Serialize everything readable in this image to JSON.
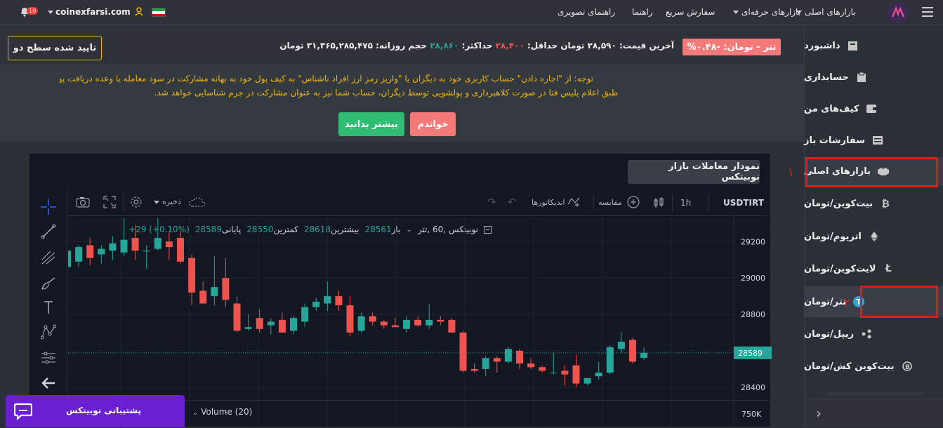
{
  "topbar": {
    "notification_count": "10",
    "domain": "coinexfarsi.com",
    "nav_main_markets": "بازارهای اصلی",
    "nav_pro_markets": "بازارهای حرفه‌ای",
    "nav_quick_order": "سفارش سریع",
    "nav_guide": "راهنما",
    "nav_video_guide": "راهنمای تصویری"
  },
  "sidebar": {
    "dashboard": "داشبورد",
    "accounting": "حسابداری",
    "wallets": "کیف‌های من",
    "open_orders": "سفارشات باز",
    "main_markets": "بازارهای اصلی",
    "btc": "بیت‌کوین/تومان",
    "eth": "اتریوم/تومان",
    "ltc": "لایت‌کوین/تومان",
    "usdt": "تتر/تومان",
    "xrp": "ریپل/تومان",
    "bch": "بیت‌کوین کش/تومان",
    "annot1": "۱",
    "annot2": "۲"
  },
  "infobar": {
    "verify_button": "تایید شده سطح دو",
    "pair_badge": "تتر - تومان: -۰.۴۸%",
    "last_price_label": "آخرین قیمت:",
    "last_price": "۲۸,۵۹۰ تومان",
    "min_label": "حداقل:",
    "min_value": "۲۸,۴۰۰",
    "max_label": "حداکثر:",
    "max_value": "۲۸,۸۶۰",
    "volume_label": "حجم روزانه:",
    "volume_value": "۳۱,۳۶۵,۲۸۵,۴۷۵ تومان"
  },
  "notice": {
    "line1": "توجه: از \"اجاره دادن\" حساب کاربری خود به دیگران یا \"واریز رمز ارز افراد ناشناس\" به کیف پول خود به بهانه مشارکت در سود معامله یا وعده دریافت پول جدا خودداری کنید.",
    "line2": "طبق اعلام پلیس فتا در صورت کلاهبرداری و پولشویی توسط دیگران، حساب شما نیز به عنوان مشارکت در جرم شناسایی خواهد شد.",
    "read_button": "خواندم",
    "learn_more_button": "بیشتر بدانید"
  },
  "chart_panel": {
    "title": "نمودار معاملات بازار نوبیتکس",
    "symbol": "USDTIRT",
    "interval": "1h",
    "compare": "مقایسه",
    "indicators": "اندیکاتورها",
    "save": "ذخیره",
    "legend_name": "نوبیتکس ,60 ,تتر",
    "open_label": "باز",
    "open_value": "28561",
    "high_label": "بیشترین",
    "high_value": "28618",
    "low_label": "کمترین",
    "low_value": "28550",
    "close_label": "پایانی",
    "close_value": "28589",
    "change": "+29 (+0.10%)",
    "volume_label": "Volume (20)",
    "volume_axis": "750K",
    "price_tag": "28589"
  },
  "support": {
    "label": "پشتیبانی نوبیتکس"
  },
  "colors": {
    "up": "#26a69a",
    "down": "#ef5350",
    "annotation": "#e21b1b",
    "accent_yellow": "#f0b90b"
  },
  "chart_data": {
    "type": "candlestick",
    "y_ticks": [
      29200,
      29000,
      28800,
      28600,
      28400
    ],
    "ylim": [
      28330,
      29340
    ],
    "last_price": 28589,
    "candles": [
      {
        "o": 29060,
        "h": 29120,
        "l": 28990,
        "c": 29150
      },
      {
        "o": 29090,
        "h": 29180,
        "l": 29060,
        "c": 29170
      },
      {
        "o": 29180,
        "h": 29220,
        "l": 29070,
        "c": 29110
      },
      {
        "o": 29130,
        "h": 29180,
        "l": 29080,
        "c": 29160
      },
      {
        "o": 29150,
        "h": 29230,
        "l": 29100,
        "c": 29190
      },
      {
        "o": 29140,
        "h": 29330,
        "l": 29120,
        "c": 29210
      },
      {
        "o": 29220,
        "h": 29290,
        "l": 29100,
        "c": 29150
      },
      {
        "o": 29150,
        "h": 29180,
        "l": 29050,
        "c": 29150
      },
      {
        "o": 29160,
        "h": 29330,
        "l": 29150,
        "c": 29220
      },
      {
        "o": 29200,
        "h": 29250,
        "l": 29100,
        "c": 29170
      },
      {
        "o": 29220,
        "h": 29260,
        "l": 29080,
        "c": 29090
      },
      {
        "o": 29110,
        "h": 29130,
        "l": 28850,
        "c": 28920
      },
      {
        "o": 28930,
        "h": 28980,
        "l": 28860,
        "c": 28860
      },
      {
        "o": 28900,
        "h": 29120,
        "l": 28850,
        "c": 28950
      },
      {
        "o": 29000,
        "h": 29110,
        "l": 28840,
        "c": 28880
      },
      {
        "o": 28860,
        "h": 28900,
        "l": 28700,
        "c": 28710
      },
      {
        "o": 28720,
        "h": 28800,
        "l": 28710,
        "c": 28730
      },
      {
        "o": 28780,
        "h": 28830,
        "l": 28700,
        "c": 28720
      },
      {
        "o": 28740,
        "h": 28780,
        "l": 28690,
        "c": 28760
      },
      {
        "o": 28770,
        "h": 28810,
        "l": 28700,
        "c": 28700
      },
      {
        "o": 28710,
        "h": 28790,
        "l": 28690,
        "c": 28780
      },
      {
        "o": 28760,
        "h": 28860,
        "l": 28730,
        "c": 28840
      },
      {
        "o": 28840,
        "h": 28890,
        "l": 28820,
        "c": 28870
      },
      {
        "o": 28860,
        "h": 28980,
        "l": 28820,
        "c": 28900
      },
      {
        "o": 28900,
        "h": 28930,
        "l": 28820,
        "c": 28850
      },
      {
        "o": 28850,
        "h": 28900,
        "l": 28680,
        "c": 28700
      },
      {
        "o": 28710,
        "h": 28810,
        "l": 28700,
        "c": 28790
      },
      {
        "o": 28790,
        "h": 28810,
        "l": 28740,
        "c": 28760
      },
      {
        "o": 28760,
        "h": 28770,
        "l": 28720,
        "c": 28740
      },
      {
        "o": 28740,
        "h": 28780,
        "l": 28730,
        "c": 28730
      },
      {
        "o": 28720,
        "h": 28790,
        "l": 28700,
        "c": 28770
      },
      {
        "o": 28770,
        "h": 28790,
        "l": 28730,
        "c": 28740
      },
      {
        "o": 28740,
        "h": 28860,
        "l": 28720,
        "c": 28770
      },
      {
        "o": 28770,
        "h": 28790,
        "l": 28740,
        "c": 28760
      },
      {
        "o": 28770,
        "h": 28780,
        "l": 28700,
        "c": 28700
      },
      {
        "o": 28700,
        "h": 28710,
        "l": 28480,
        "c": 28490
      },
      {
        "o": 28500,
        "h": 28530,
        "l": 28480,
        "c": 28490
      },
      {
        "o": 28500,
        "h": 28570,
        "l": 28460,
        "c": 28560
      },
      {
        "o": 28560,
        "h": 28570,
        "l": 28480,
        "c": 28540
      },
      {
        "o": 28540,
        "h": 28620,
        "l": 28530,
        "c": 28610
      },
      {
        "o": 28600,
        "h": 28610,
        "l": 28500,
        "c": 28530
      },
      {
        "o": 28530,
        "h": 28560,
        "l": 28500,
        "c": 28510
      },
      {
        "o": 28510,
        "h": 28520,
        "l": 28480,
        "c": 28490
      },
      {
        "o": 28480,
        "h": 28590,
        "l": 28470,
        "c": 28480
      },
      {
        "o": 28490,
        "h": 28520,
        "l": 28410,
        "c": 28470
      },
      {
        "o": 28520,
        "h": 28580,
        "l": 28400,
        "c": 28420
      },
      {
        "o": 28420,
        "h": 28450,
        "l": 28410,
        "c": 28450
      },
      {
        "o": 28460,
        "h": 28540,
        "l": 28440,
        "c": 28480
      },
      {
        "o": 28480,
        "h": 28630,
        "l": 28470,
        "c": 28620
      },
      {
        "o": 28610,
        "h": 28700,
        "l": 28590,
        "c": 28650
      },
      {
        "o": 28660,
        "h": 28670,
        "l": 28530,
        "c": 28540
      },
      {
        "o": 28561,
        "h": 28618,
        "l": 28550,
        "c": 28589
      }
    ]
  }
}
